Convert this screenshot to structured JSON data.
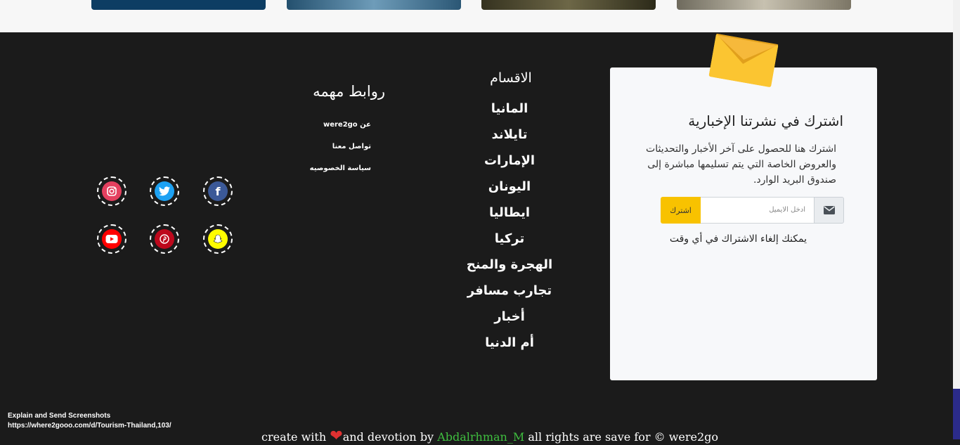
{
  "newsletter": {
    "title": "اشترك في نشرتنا الإخبارية",
    "description": "اشترك هنا للحصول على آخر الأخبار والتحديثات والعروض الخاصة التي يتم تسليمها مباشرة إلى صندوق البريد الوارد.",
    "email_placeholder": "ادخل الايميل",
    "subscribe_label": "اشترك",
    "unsubscribe_note": "يمكنك إلغاء الاشتراك في أي وقت"
  },
  "categories": {
    "title": "الاقسام",
    "items": [
      "المانيا",
      "تايلاند",
      "الإمارات",
      "اليونان",
      "ايطاليا",
      "تركيا",
      "الهجرة والمنح",
      "تجارب مسافر",
      "أخبار",
      "أم الدنيا"
    ]
  },
  "links": {
    "title": "روابط مهمه",
    "items": [
      "عن were2go",
      "تواصل معنا",
      "سياسة الخصوصيه"
    ]
  },
  "social": {
    "icons": [
      "facebook-icon",
      "twitter-icon",
      "instagram-icon",
      "snapchat-icon",
      "pinterest-icon",
      "youtube-icon"
    ],
    "colors": {
      "facebook": "#3b5998",
      "twitter": "#1da1f2",
      "instagram": "#e4405f",
      "snapchat": "#fffc00",
      "pinterest": "#bd081c",
      "youtube": "#ff0000"
    }
  },
  "overlay": {
    "line1": "Explain and Send Screenshots",
    "line2": "https://where2gooo.com/d/Tourism-Thailand,103/"
  },
  "credit": {
    "prefix": "create with",
    "middle": "and devotion by",
    "author": "Abdalrhman_M",
    "suffix": "all rights are save for © were2go"
  },
  "colors": {
    "accent": "#f8c200",
    "footer_bg": "#1b1b1b",
    "author": "#3fbf3f",
    "heart": "#e03131"
  }
}
